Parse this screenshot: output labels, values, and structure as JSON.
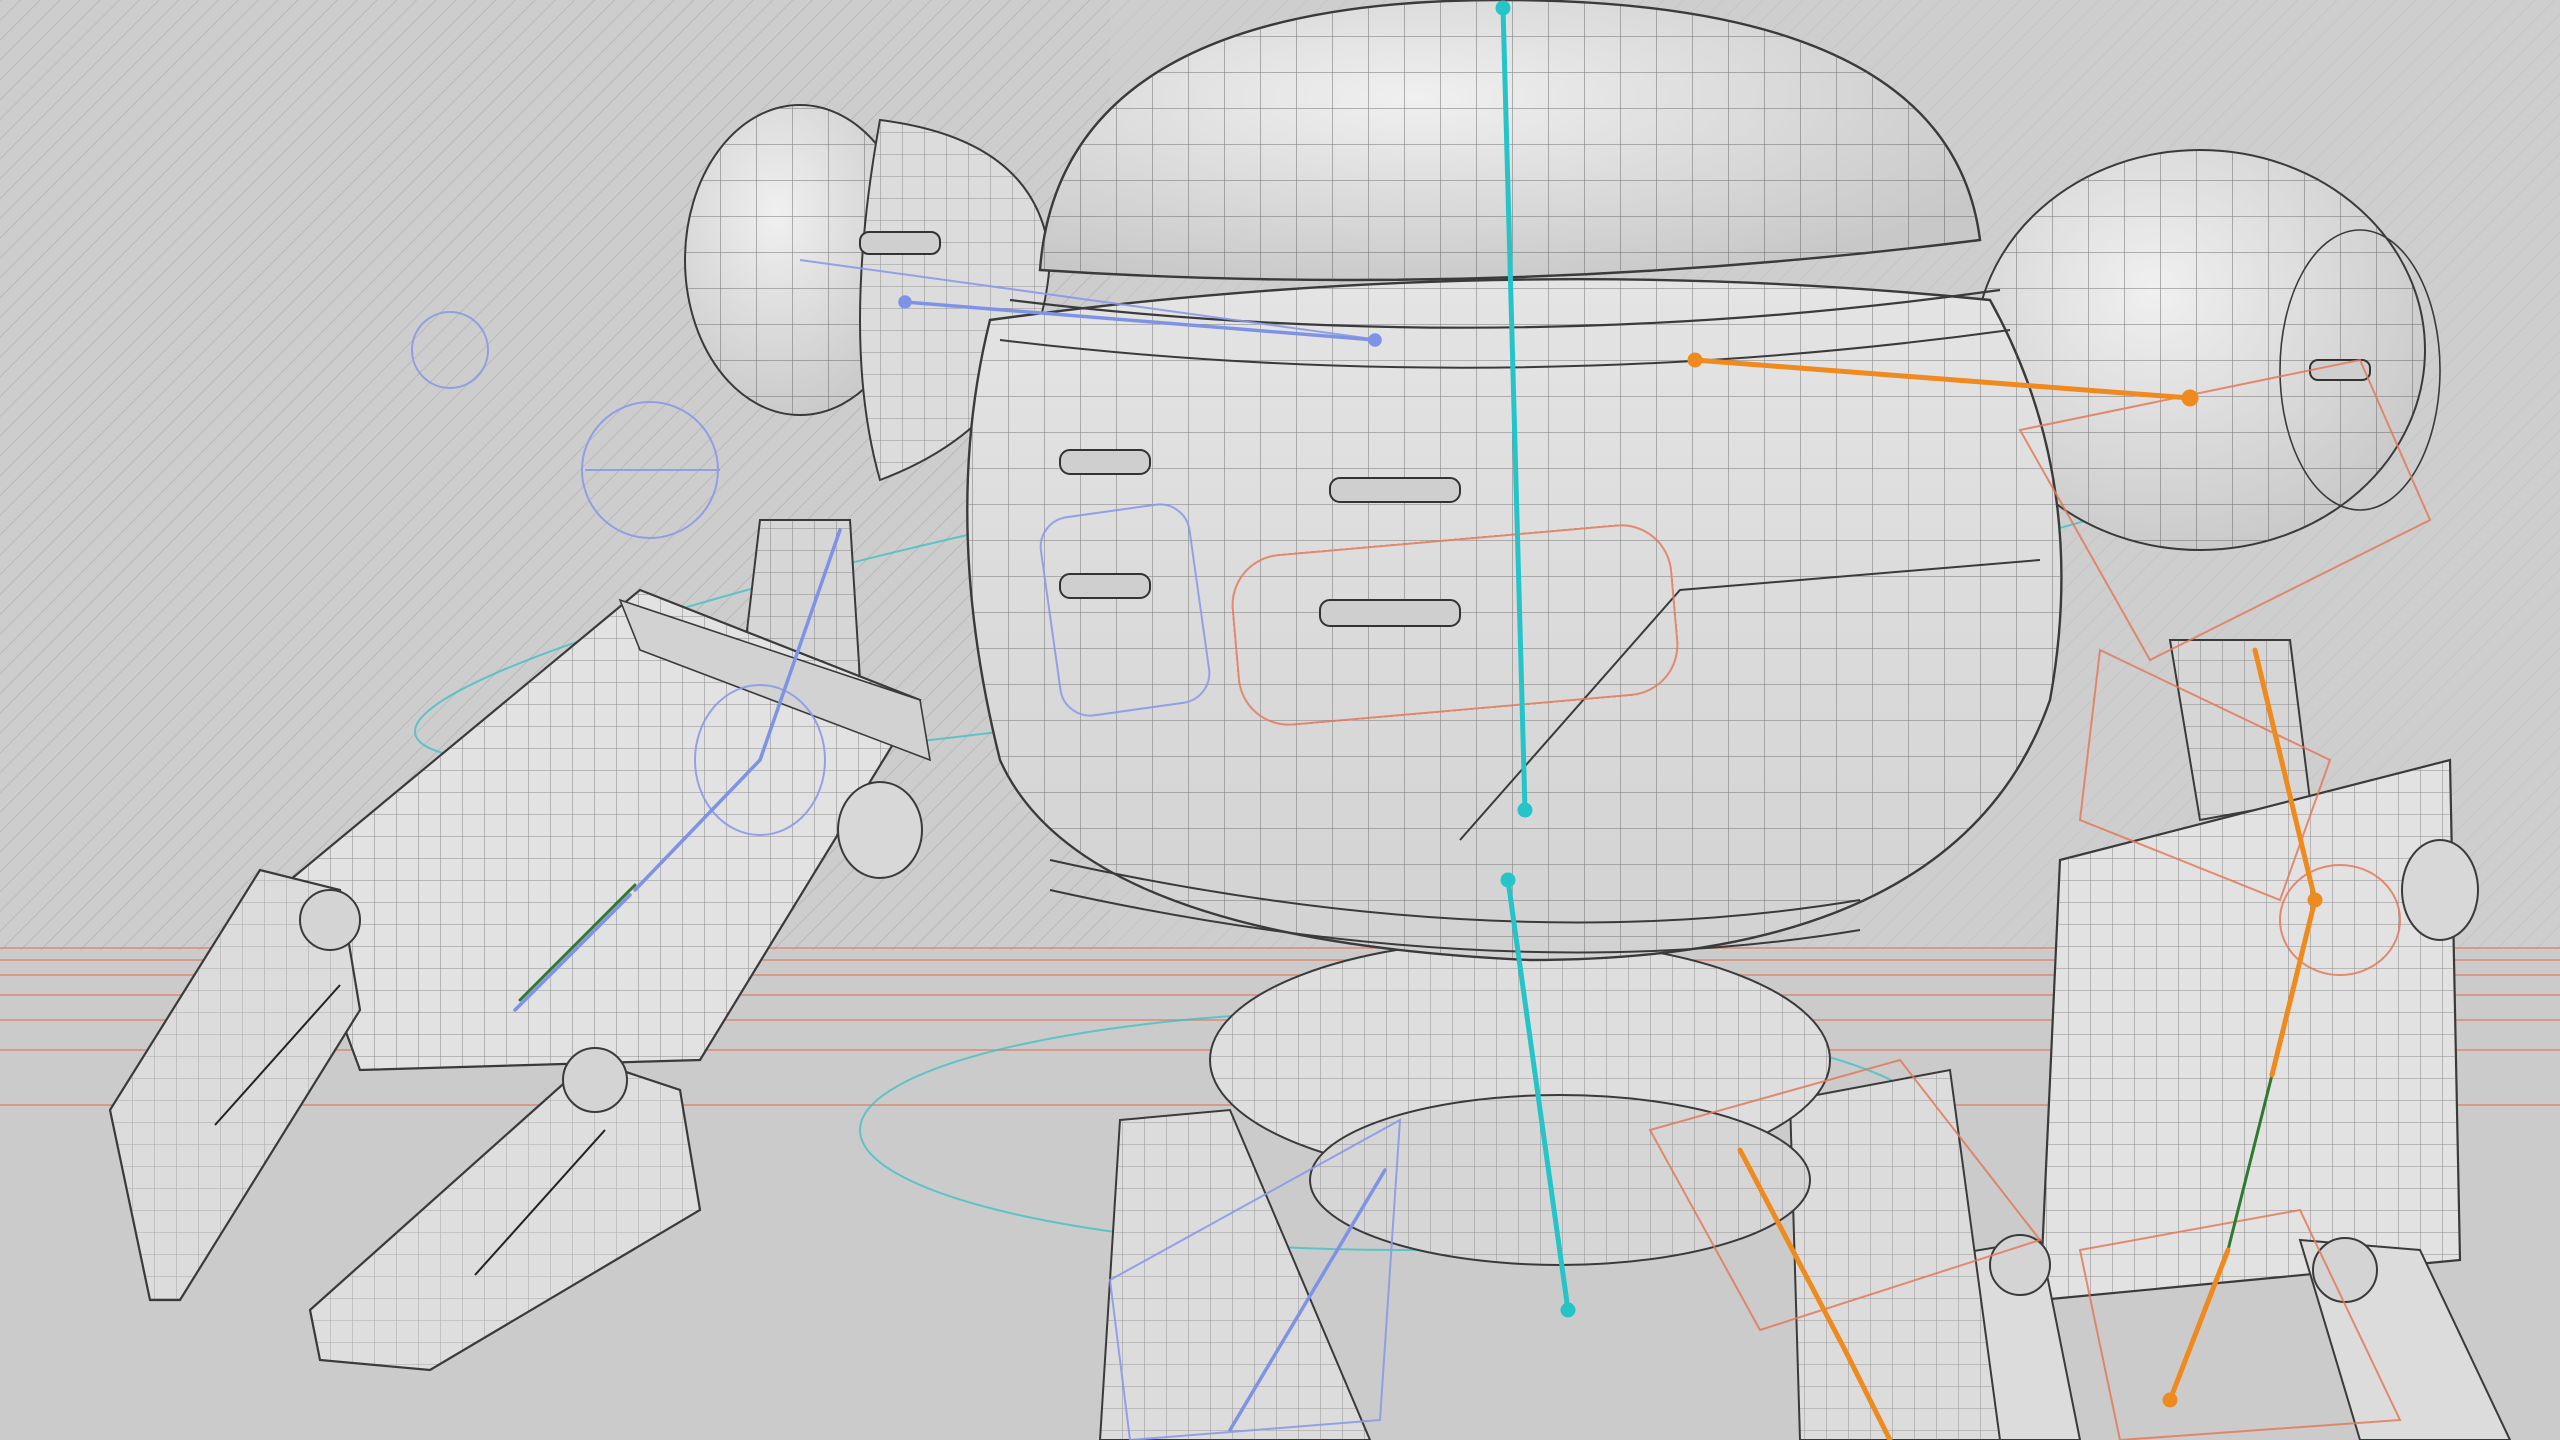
{
  "scene": {
    "description_visible_text": "",
    "colors": {
      "background": "#c9c9c9",
      "back_wall": "#cdcdcd",
      "wall_hatch": "#b9b9b9",
      "floor": "#cbcbcb",
      "floor_grid": "#e07a5f",
      "mesh_fill": "#e6e6e6",
      "mesh_shade": "#cfcfcf",
      "mesh_wire": "#3a3a3a",
      "bone_center": "#25c4c8",
      "bone_left": "#7f93e6",
      "bone_right": "#ee8a1e",
      "control_left": "#8a9ae8",
      "control_right": "#e27a5a",
      "control_center": "#39c0c4",
      "bone_green": "#2f7a2f"
    },
    "icons": []
  }
}
